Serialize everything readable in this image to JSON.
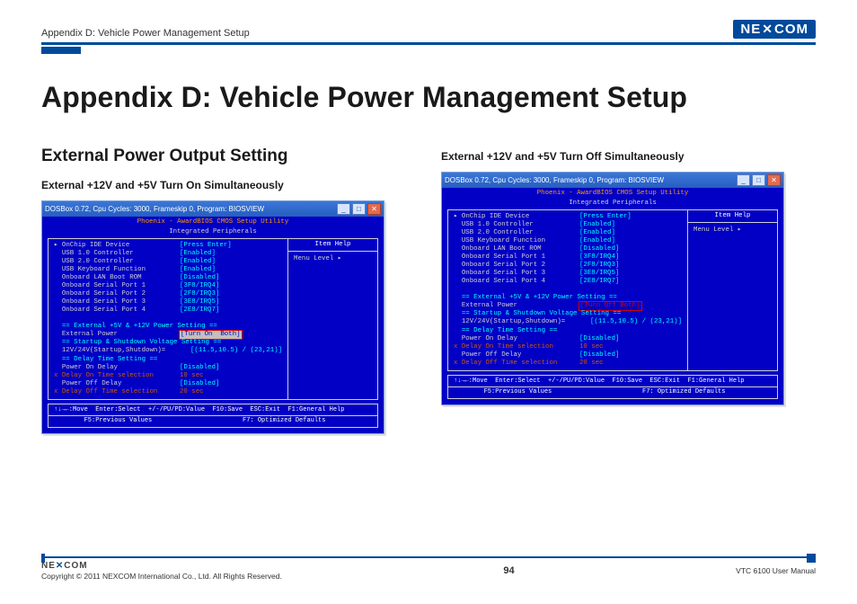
{
  "header": {
    "breadcrumb": "Appendix D: Vehicle Power Management Setup",
    "logo": "NEXCOM"
  },
  "title": "Appendix D: Vehicle Power Management Setup",
  "section_heading": "External Power Output Setting",
  "left": {
    "subheading": "External +12V and +5V Turn On Simultaneously",
    "win_title": "DOSBox 0.72, Cpu Cycles:    3000, Frameskip  0, Program: BIOSVIEW",
    "bios_title1": "Phoenix - AwardBIOS CMOS Setup Utility",
    "bios_title2": "Integrated Peripherals",
    "right_heading": "Item Help",
    "right_line": "Menu Level   ▸",
    "rows": [
      {
        "label": "▸ OnChip IDE Device",
        "value": "[Press Enter]"
      },
      {
        "label": "  USB 1.0 Controller",
        "value": "[Enabled]"
      },
      {
        "label": "  USB 2.0 Controller",
        "value": "[Enabled]"
      },
      {
        "label": "  USB Keyboard Function",
        "value": "[Enabled]"
      },
      {
        "label": "  Onboard LAN Boot ROM",
        "value": "[Disabled]"
      },
      {
        "label": "  Onboard Serial Port 1",
        "value": "[3F8/IRQ4]"
      },
      {
        "label": "  Onboard Serial Port 2",
        "value": "[2F8/IRQ3]"
      },
      {
        "label": "  Onboard Serial Port 3",
        "value": "[3E8/IRQ5]"
      },
      {
        "label": "  Onboard Serial Port 4",
        "value": "[2E8/IRQ7]"
      }
    ],
    "sec1": "  == External +5V & +12V Power Setting ==",
    "ext_power_label": "  External Power",
    "ext_power_value": "[Turn On  Both]",
    "sec2": "  == Startup & Shutdown Voltage Setting ==",
    "volt_label": "  12V/24V(Startup,Shutdown)=",
    "volt_value": "[(11.5,10.5) / (23,21)]",
    "sec3": "  == Delay Time Setting ==",
    "rows2": [
      {
        "label": "  Power On Delay",
        "value": "[Disabled]"
      },
      {
        "label": "x Delay On Time selection",
        "value": "10 sec",
        "x": true
      },
      {
        "label": "  Power Off Delay",
        "value": "[Disabled]"
      },
      {
        "label": "x Delay Off Time selection",
        "value": "20 sec",
        "x": true
      }
    ],
    "help1": "↑↓→←:Move  Enter:Select  +/-/PU/PD:Value  F10:Save  ESC:Exit  F1:General Help",
    "help2": "        F5:Previous Values                        F7: Optimized Defaults"
  },
  "right": {
    "subheading": "External +12V and +5V Turn Off Simultaneously",
    "win_title": "DOSBox 0.72, Cpu Cycles:    3000, Frameskip  0, Program: BIOSVIEW",
    "bios_title1": "Phoenix - AwardBIOS CMOS Setup Utility",
    "bios_title2": "Integrated Peripherals",
    "right_heading": "Item Help",
    "right_line": "Menu Level   ▸",
    "rows": [
      {
        "label": "▸ OnChip IDE Device",
        "value": "[Press Enter]"
      },
      {
        "label": "  USB 1.0 Controller",
        "value": "[Enabled]"
      },
      {
        "label": "  USB 2.0 Controller",
        "value": "[Enabled]"
      },
      {
        "label": "  USB Keyboard Function",
        "value": "[Enabled]"
      },
      {
        "label": "  Onboard LAN Boot ROM",
        "value": "[Disabled]"
      },
      {
        "label": "  Onboard Serial Port 1",
        "value": "[3F8/IRQ4]"
      },
      {
        "label": "  Onboard Serial Port 2",
        "value": "[2F8/IRQ3]"
      },
      {
        "label": "  Onboard Serial Port 3",
        "value": "[3E8/IRQ5]"
      },
      {
        "label": "  Onboard Serial Port 4",
        "value": "[2E8/IRQ7]"
      }
    ],
    "sec1": "  == External +5V & +12V Power Setting ==",
    "ext_power_label": "  External Power",
    "ext_power_value": "[Turn Off Both]",
    "sec2": "  == Startup & Shutdown Voltage Setting ==",
    "volt_label": "  12V/24V(Startup,Shutdown)=",
    "volt_value": "[(11.5,10.5) / (23,21)]",
    "sec3": "  == Delay Time Setting ==",
    "rows2": [
      {
        "label": "  Power On Delay",
        "value": "[Disabled]"
      },
      {
        "label": "x Delay On Time selection",
        "value": "10 sec",
        "x": true
      },
      {
        "label": "  Power Off Delay",
        "value": "[Disabled]"
      },
      {
        "label": "x Delay Off Time selection",
        "value": "20 sec",
        "x": true
      }
    ],
    "help1": "↑↓→←:Move  Enter:Select  +/-/PU/PD:Value  F10:Save  ESC:Exit  F1:General Help",
    "help2": "        F5:Previous Values                        F7: Optimized Defaults"
  },
  "footer": {
    "logo": "NEXCOM",
    "copyright": "Copyright © 2011 NEXCOM International Co., Ltd. All Rights Reserved.",
    "page": "94",
    "doc": "VTC 6100 User Manual"
  }
}
